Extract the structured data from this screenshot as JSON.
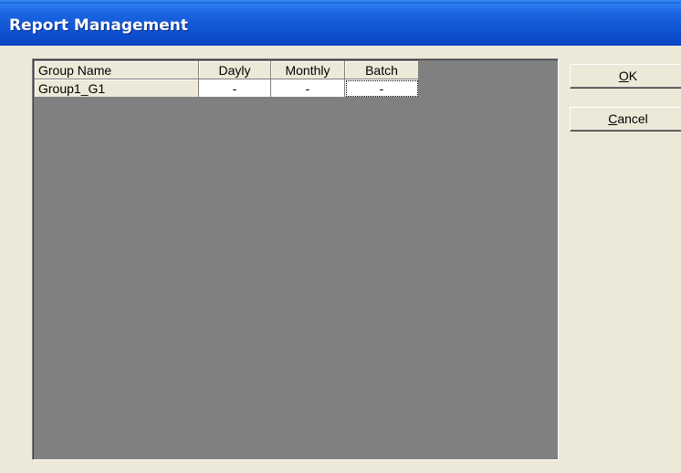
{
  "window": {
    "title": "Report Management"
  },
  "grid": {
    "columns": [
      "Group Name",
      "Dayly",
      "Monthly",
      "Batch"
    ],
    "rows": [
      {
        "name": "Group1_G1",
        "daily": "-",
        "monthly": "-",
        "batch": "-"
      }
    ]
  },
  "buttons": {
    "ok": {
      "accel": "O",
      "rest": "K"
    },
    "cancel": {
      "accel": "C",
      "rest": "ancel"
    }
  },
  "colors": {
    "titlebar": "#0a46c4",
    "dialog_bg": "#ece9d8",
    "grid_bg": "#808080"
  }
}
